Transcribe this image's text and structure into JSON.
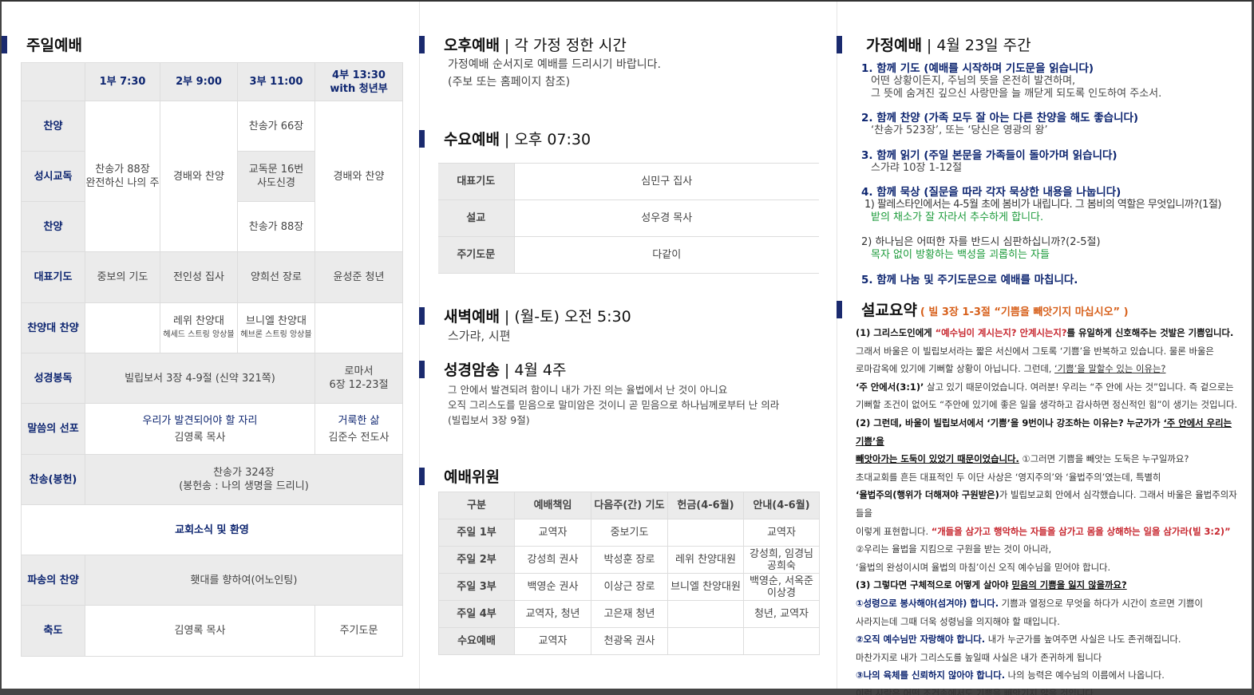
{
  "sunday": {
    "title": "주일예배",
    "headers": [
      "1부 7:30",
      "2부 9:00",
      "3부 11:00",
      "4부 13:30\nwith 청년부"
    ],
    "rows": {
      "hymn1": "찬양",
      "creed": "성시교독",
      "hymn2": "찬양",
      "prayer": "대표기도",
      "choir": "찬양대 찬양",
      "reading": "성경봉독",
      "sermon": "말씀의 선포",
      "offering": "찬송(봉헌)",
      "sending": "파송의 찬양",
      "blessing": "축도"
    },
    "c1_top": "찬송가 88장\n완전하신 나의 주",
    "c2_top": "경배와 찬양",
    "c3_hymn1": "찬송가 66장",
    "c3_creed": "교독문 16번\n사도신경",
    "c3_hymn2": "찬송가 88장",
    "c4_top": "경배와 찬양",
    "prayer": [
      "중보의 기도",
      "전인성 집사",
      "양희선 장로",
      "윤성준 청년"
    ],
    "choir_c2": "레위 찬양대",
    "choir_c2_sub": "헤세드 스트링 앙상블",
    "choir_c3": "브니엘 찬양대",
    "choir_c3_sub": "헤브론 스트링 앙상블",
    "reading_main": "빌립보서 3장 4-9절 (신약 321쪽)",
    "reading_c4": "로마서\n6장 12-23절",
    "sermon_title": "우리가 발견되어야 할 자리",
    "sermon_speaker": "김영록 목사",
    "sermon_c4_title": "거룩한 삶",
    "sermon_c4_speaker": "김준수 전도사",
    "offering": "찬송가 324장\n(봉헌송 : 나의 생명을 드리니)",
    "news": "교회소식 및 환영",
    "sending": "횃대를 향하여(어노인팅)",
    "blessing_main": "김영록 목사",
    "blessing_c4": "주기도문"
  },
  "afternoon": {
    "title": "오후예배",
    "subtitle": "각 가정 정한 시간",
    "line1": "가정예배 순서지로 예배를 드리시기 바랍니다.",
    "line2": "(주보 또는 홈페이지 참조)"
  },
  "wednesday": {
    "title": "수요예배",
    "subtitle": "오후 07:30",
    "rows": [
      {
        "label": "대표기도",
        "value": "심민구 집사"
      },
      {
        "label": "설교",
        "value": "성우경 목사"
      },
      {
        "label": "주기도문",
        "value": "다같이"
      }
    ]
  },
  "dawn": {
    "title": "새벽예배",
    "subtitle": "(월-토) 오전 5:30",
    "line1": "스가랴, 시편"
  },
  "memory": {
    "title": "성경암송",
    "subtitle": "4월 4주",
    "line1": "그 안에서 발견되려 함이니 내가 가진 의는 율법에서 난 것이 아니요",
    "line2": "오직 그리스도를 믿음으로 말미암은 것이니 곧 믿음으로 하나님께로부터 난 의라",
    "line3": "(빌립보서 3장 9절)"
  },
  "staff": {
    "title": "예배위원",
    "headers": [
      "구분",
      "예배책임",
      "다음주(간) 기도",
      "헌금(4-6월)",
      "안내(4-6월)"
    ],
    "rows": [
      [
        "주일 1부",
        "교역자",
        "중보기도",
        "",
        "교역자"
      ],
      [
        "주일 2부",
        "강성희 권사",
        "박성훈 장로",
        "레위 찬양대원",
        "강성희, 임경님\n공희숙"
      ],
      [
        "주일 3부",
        "백영순 권사",
        "이상근 장로",
        "브니엘 찬양대원",
        "백영순, 서옥준\n이상경"
      ],
      [
        "주일 4부",
        "교역자, 청년",
        "고은재 청년",
        "",
        "청년, 교역자"
      ],
      [
        "수요예배",
        "교역자",
        "천광옥 권사",
        "",
        ""
      ]
    ]
  },
  "home": {
    "title": "가정예배",
    "subtitle": "4월 23일 주간",
    "i1_h": "1. 함께 기도 (예배를 시작하며 기도문을 읽습니다)",
    "i1_t1": "어떤 상황이든지, 주님의 뜻을 온전히 발견하며,",
    "i1_t2": "그 뜻에 숨겨진 깊으신 사랑만을 늘 깨닫게 되도록 인도하여 주소서.",
    "i2_h": "2. 함께 찬양 (가족 모두 잘 아는 다른 찬양을 해도 좋습니다)",
    "i2_t1": "‘찬송가 523장’, 또는 ‘당신은 영광의 왕’",
    "i3_h": "3. 함께 읽기 (주일 본문을 가족들이 돌아가며 읽습니다)",
    "i3_t1": "스가랴 10장 1-12절",
    "i4_h": "4. 함께 묵상 (질문을 따라 각자 묵상한 내용을 나눕니다)",
    "i4_q1": "1) 팔레스타인에서는 4-5월 초에 봄비가 내립니다. 그 봄비의 역할은 무엇입니까?(1절)",
    "i4_a1": "밭의 채소가 잘 자라서 추수하게 합니다.",
    "i4_q2": "2) 하나님은 어떠한 자를 반드시 심판하십니까?(2-5절)",
    "i4_a2": "목자 없이 방황하는 백성을 괴롭히는 자들",
    "i5_h": "5. 함께 나눔 및 주기도문으로 예배를 마칩니다."
  },
  "summary": {
    "title": "설교요약",
    "ref": "( 빌 3장 1-3절 “기쁨을 빼앗기지 마십시오” )",
    "p1a": "(1) 그리스도인에게 ",
    "p1b": "“예수님이 계시는지? 안계시는지?",
    "p1c": "를 유일하게 신호해주는 것발은 기쁨입니다.",
    "l2": "그래서 바울은 이 빌립보서라는 짧은 서신에서 그토록 ‘기쁨’을 반복하고 있습니다. 물론 바울은",
    "l3a": "로마감옥에 있기에 기뻐할 상황이 아닙니다. 그런데, ",
    "l3b": "‘기쁨’을 말할수 있는 이유는?",
    "l4a": "‘주 안에서(3:1)’",
    "l4b": " 살고 있기 때문이었습니다. 여러분! 우리는 “주 안에 사는 것”입니다. 즉 겉으로는",
    "l5": "기뻐할 조건이 없어도 “주안에 있기에 좋은 일을 생각하고 감사하면 정신적인 힘”이 생기는 것입니다.",
    "l6a": "(2) 그런데, 바울이 빌립보서에서 ‘기쁨’을 9번이나 강조하는 이유는? 누군가가 ",
    "l6b": "‘주 안에서 우리는 기쁨’을",
    "l7a": "빼앗아가는 도둑이 있었기 때문이었습니다.",
    "l7b": " ①그러면 기쁨을 빼앗는 도둑은 누구일까요?",
    "l8": "초대교회를 흔든 대표적인 두 이단 사상은 ‘영지주의’와 ‘율법주의’였는데, 특별히",
    "l9a": "‘율법주의(행위가 더해져야 구원받은)",
    "l9b": "가 빌립보교회 안에서 심각했습니다. 그래서 바울은 율법주의자들을",
    "l10a": "이렇게 표현합니다. ",
    "l10b": "“개들을 삼가고 행악하는 자들을 삼가고 몸을 상해하는 일을 삼가라(빌 3:2)”",
    "l11": "②우리는 율법을 지킴으로 구원을 받는 것이 아니라,",
    "l12": "‘율법의 완성이시며 율법의 마침’이신 오직 예수님을 믿어야 합니다.",
    "l13a": "(3) 그렇다면 구체적으로 어떻게 살아야 ",
    "l13b": "믿음의 기쁨을 잃지 않을까요?",
    "l14a": "①성령으로 봉사해야(섬겨야) 합니다.",
    "l14b": " 기쁨과 열정으로 무엇을 하다가 시간이 흐르면 기쁨이",
    "l15": "사라지는데 그때 더욱 성령님을 의지해야 할 때입니다.",
    "l16a": "②오직 예수님만 자랑해야 합니다.",
    "l16b": " 내가 누군가를 높여주면 사실은 나도 존귀해집니다.",
    "l17": "마찬가지로 내가 그리스도를 높일때 사실은 내가 존귀하게 됩니다",
    "l18a": "③나의 육체를 신뢰하지 않아야 합니다.",
    "l18b": " 나의 능력은 예수님의 이름에서 나옵니다.",
    "l19": "이런 사람은 어떤 조건속에서도 기쁨을 빼앗기지 않을 것입니다."
  },
  "colors": {
    "navy": "#0d2570",
    "bar": "#1a2a6e",
    "green": "#1b9a3a",
    "red": "#c7262e",
    "orange": "#d7601b",
    "cellgray": "#ebebeb"
  }
}
